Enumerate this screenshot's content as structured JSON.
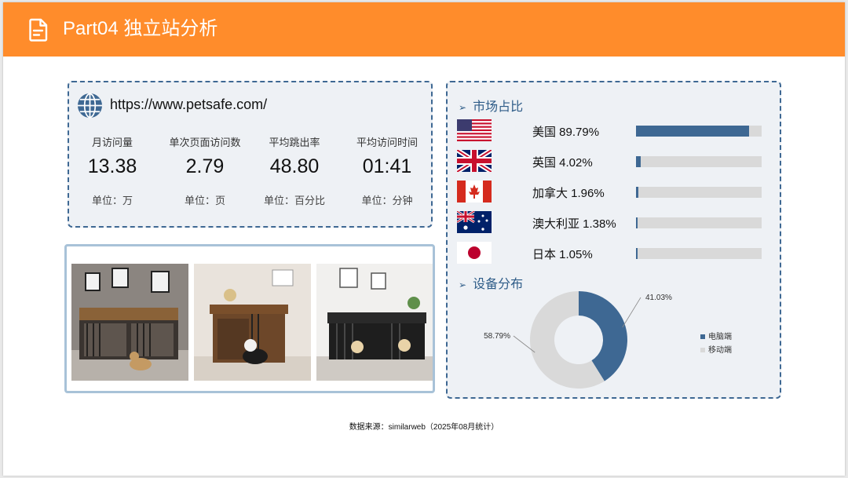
{
  "header": {
    "title": "Part04 独立站分析",
    "icon": "document-icon"
  },
  "site": {
    "url": "https://www.petsafe.com/",
    "metrics": [
      {
        "label": "月访问量",
        "value": "13.38",
        "unit": "单位：万"
      },
      {
        "label": "单次页面访问数",
        "value": "2.79",
        "unit": "单位：页"
      },
      {
        "label": "平均跳出率",
        "value": "48.80",
        "unit": "单位：百分比"
      },
      {
        "label": "平均访问时间",
        "value": "01:41",
        "unit": "单位：分钟"
      }
    ]
  },
  "market": {
    "title": "市场占比",
    "bar_color": "#3e6893",
    "track_color": "#d9d9d9",
    "items": [
      {
        "flag": "us-flag",
        "label": "美国 89.79%",
        "value": 89.79
      },
      {
        "flag": "uk-flag",
        "label": "英国 4.02%",
        "value": 4.02
      },
      {
        "flag": "canada-flag",
        "label": "加拿大 1.96%",
        "value": 1.96
      },
      {
        "flag": "australia-flag",
        "label": "澳大利亚 1.38%",
        "value": 1.38
      },
      {
        "flag": "japan-flag",
        "label": "日本 1.05%",
        "value": 1.05
      }
    ]
  },
  "devices": {
    "title": "设备分布",
    "chart_data": {
      "type": "pie",
      "labels": [
        "电脑端",
        "移动端"
      ],
      "values": [
        41.03,
        58.79
      ],
      "value_labels": [
        "41.03%",
        "58.79%"
      ],
      "colors": [
        "#3e6893",
        "#d9d9d9"
      ],
      "legend": "right"
    }
  },
  "source": "数据来源：similarweb（2025年08月统计）"
}
